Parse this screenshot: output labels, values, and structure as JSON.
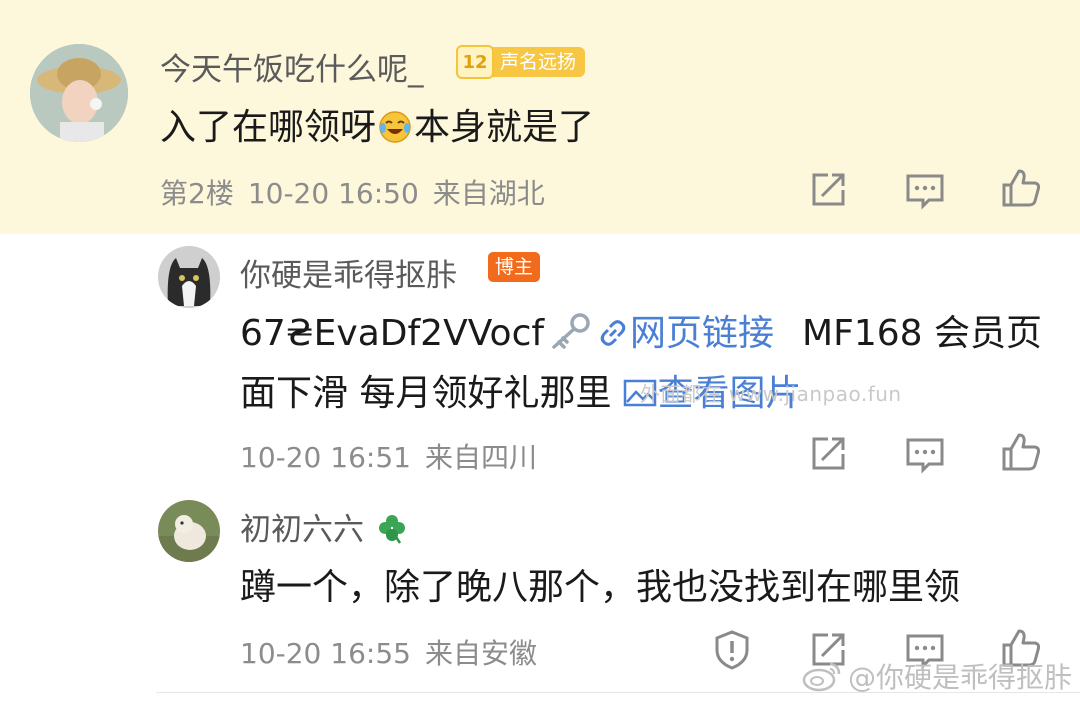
{
  "comments": [
    {
      "username": "今天午饭吃什么呢_",
      "badge_level": "12",
      "badge_text": "声名远扬",
      "text_part1": "入了在哪领呀",
      "text_part2": "本身就是了",
      "meta_floor": "第2楼",
      "meta_time": "10-20 16:50",
      "meta_location": "来自湖北"
    },
    {
      "username": "你硬是乖得抠胩",
      "role_badge": "博主",
      "line1_code": "67₴EvaDf2VVocf",
      "line1_link": "网页链接",
      "line1_rest": "MF168 会员页",
      "line2_text": "面下滑 每月领好礼那里",
      "line2_link": "查看图片",
      "meta_time": "10-20 16:51",
      "meta_location": "来自四川"
    },
    {
      "username": "初初六六",
      "text": "蹲一个，除了晚八那个，我也没找到在哪里领",
      "meta_time": "10-20 16:55",
      "meta_location": "来自安徽"
    }
  ],
  "watermarks": {
    "middle": "外面都在 www.jianpao.fun",
    "bottom_right": "@你硬是乖得抠胩"
  },
  "icons": [
    "share-icon",
    "comment-icon",
    "like-icon",
    "report-icon",
    "key-icon",
    "link-icon",
    "image-icon",
    "clover-icon",
    "laughing-crying-emoji",
    "weibo-logo-icon"
  ],
  "colors": {
    "highlight_bg": "#fdf7dc",
    "link": "#4a7fd6",
    "host_badge": "#f26a1b",
    "fame_badge": "#f7c743"
  }
}
